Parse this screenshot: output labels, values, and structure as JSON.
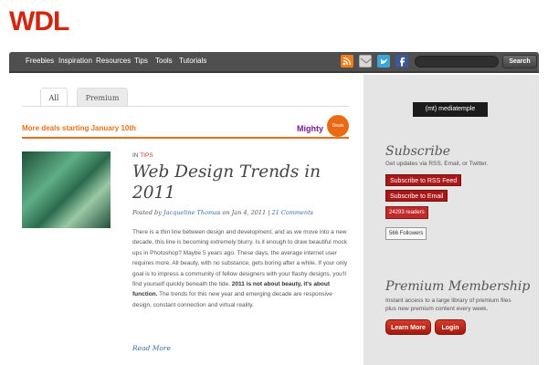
{
  "logo": "WDL",
  "nav": {
    "items": [
      "Freebies",
      "Inspiration",
      "Resources",
      "Tips",
      "Tools",
      "Tutorials"
    ],
    "search_button": "Search",
    "icons": [
      "rss-icon",
      "mail-icon",
      "twitter-icon",
      "facebook-icon"
    ]
  },
  "tabs": [
    "All",
    "Premium"
  ],
  "deals": {
    "text": "More deals starting January 10th",
    "brand": "Mighty",
    "badge": "Deals"
  },
  "post": {
    "category_prefix": "IN",
    "category": "TIPS",
    "title": "Web Design Trends in 2011",
    "posted_by": "Posted by",
    "author": "Jacqueline Thomas",
    "date": "on Jan 4, 2011",
    "comments": "21 Comments",
    "excerpt_1": "There is a thin line between design and development, and as we move into a new decade, this line is becoming extremely blurry. Is it enough to draw beautiful mock ups in Photoshop? Maybe 5 years ago. These days, the average internet user requires more. All beauty, with no substance, gets boring after a while. If your only goal is to impress a community of fellow designers with your flashy designs, you'll find yourself quickly beneath the tide.",
    "excerpt_bold": "2011 is not about beauty, it's about function.",
    "excerpt_2": "The trends for this new year and emerging decade are responsive design, constant connection and virtual reality.",
    "read_more": "Read More"
  },
  "sidebar": {
    "sponsor": "(mt) mediatemple",
    "subscribe": {
      "heading": "Subscribe",
      "text": "Get updates via RSS, Email, or Twitter.",
      "rss_button": "Subscribe to RSS Feed",
      "email_button": "Subscribe to Email",
      "readers_count": "24293",
      "readers_label": "readers",
      "followers_count": "566",
      "followers_label": "Followers"
    },
    "premium": {
      "heading": "Premium Membership",
      "text": "Instant access to a large library of premium files plus new premium content every week.",
      "learn_more": "Learn More",
      "login": "Login"
    }
  },
  "colors": {
    "brand_red": "#d22610",
    "nav_bg": "#4f4f4f",
    "accent_orange": "#e8701b",
    "sidebar_bg": "#e5e5e5",
    "link_blue": "#3a6ea5"
  }
}
